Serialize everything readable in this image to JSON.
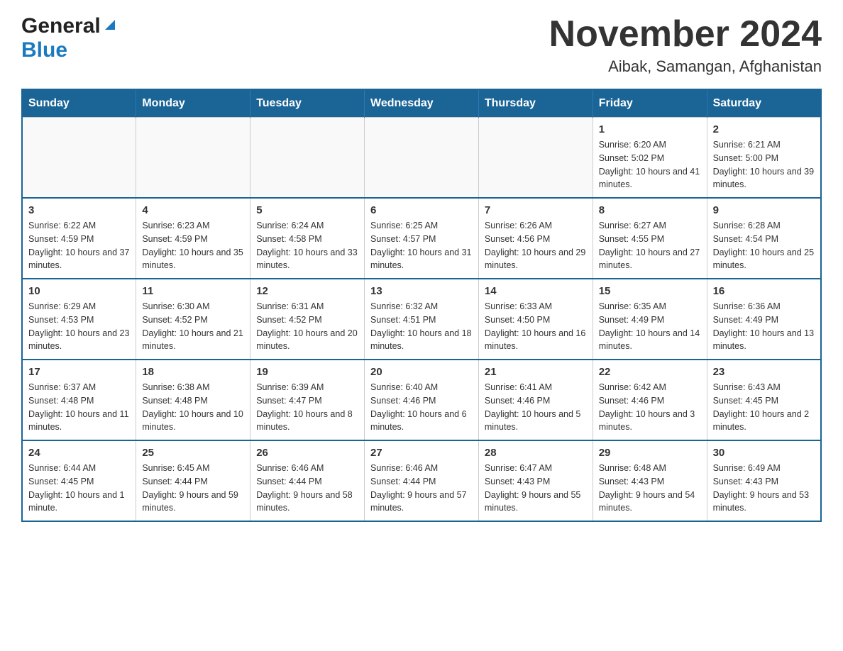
{
  "header": {
    "logo_general": "General",
    "logo_blue": "Blue",
    "month_title": "November 2024",
    "location": "Aibak, Samangan, Afghanistan"
  },
  "weekdays": [
    "Sunday",
    "Monday",
    "Tuesday",
    "Wednesday",
    "Thursday",
    "Friday",
    "Saturday"
  ],
  "weeks": [
    {
      "days": [
        {
          "number": "",
          "info": ""
        },
        {
          "number": "",
          "info": ""
        },
        {
          "number": "",
          "info": ""
        },
        {
          "number": "",
          "info": ""
        },
        {
          "number": "",
          "info": ""
        },
        {
          "number": "1",
          "info": "Sunrise: 6:20 AM\nSunset: 5:02 PM\nDaylight: 10 hours and 41 minutes."
        },
        {
          "number": "2",
          "info": "Sunrise: 6:21 AM\nSunset: 5:00 PM\nDaylight: 10 hours and 39 minutes."
        }
      ]
    },
    {
      "days": [
        {
          "number": "3",
          "info": "Sunrise: 6:22 AM\nSunset: 4:59 PM\nDaylight: 10 hours and 37 minutes."
        },
        {
          "number": "4",
          "info": "Sunrise: 6:23 AM\nSunset: 4:59 PM\nDaylight: 10 hours and 35 minutes."
        },
        {
          "number": "5",
          "info": "Sunrise: 6:24 AM\nSunset: 4:58 PM\nDaylight: 10 hours and 33 minutes."
        },
        {
          "number": "6",
          "info": "Sunrise: 6:25 AM\nSunset: 4:57 PM\nDaylight: 10 hours and 31 minutes."
        },
        {
          "number": "7",
          "info": "Sunrise: 6:26 AM\nSunset: 4:56 PM\nDaylight: 10 hours and 29 minutes."
        },
        {
          "number": "8",
          "info": "Sunrise: 6:27 AM\nSunset: 4:55 PM\nDaylight: 10 hours and 27 minutes."
        },
        {
          "number": "9",
          "info": "Sunrise: 6:28 AM\nSunset: 4:54 PM\nDaylight: 10 hours and 25 minutes."
        }
      ]
    },
    {
      "days": [
        {
          "number": "10",
          "info": "Sunrise: 6:29 AM\nSunset: 4:53 PM\nDaylight: 10 hours and 23 minutes."
        },
        {
          "number": "11",
          "info": "Sunrise: 6:30 AM\nSunset: 4:52 PM\nDaylight: 10 hours and 21 minutes."
        },
        {
          "number": "12",
          "info": "Sunrise: 6:31 AM\nSunset: 4:52 PM\nDaylight: 10 hours and 20 minutes."
        },
        {
          "number": "13",
          "info": "Sunrise: 6:32 AM\nSunset: 4:51 PM\nDaylight: 10 hours and 18 minutes."
        },
        {
          "number": "14",
          "info": "Sunrise: 6:33 AM\nSunset: 4:50 PM\nDaylight: 10 hours and 16 minutes."
        },
        {
          "number": "15",
          "info": "Sunrise: 6:35 AM\nSunset: 4:49 PM\nDaylight: 10 hours and 14 minutes."
        },
        {
          "number": "16",
          "info": "Sunrise: 6:36 AM\nSunset: 4:49 PM\nDaylight: 10 hours and 13 minutes."
        }
      ]
    },
    {
      "days": [
        {
          "number": "17",
          "info": "Sunrise: 6:37 AM\nSunset: 4:48 PM\nDaylight: 10 hours and 11 minutes."
        },
        {
          "number": "18",
          "info": "Sunrise: 6:38 AM\nSunset: 4:48 PM\nDaylight: 10 hours and 10 minutes."
        },
        {
          "number": "19",
          "info": "Sunrise: 6:39 AM\nSunset: 4:47 PM\nDaylight: 10 hours and 8 minutes."
        },
        {
          "number": "20",
          "info": "Sunrise: 6:40 AM\nSunset: 4:46 PM\nDaylight: 10 hours and 6 minutes."
        },
        {
          "number": "21",
          "info": "Sunrise: 6:41 AM\nSunset: 4:46 PM\nDaylight: 10 hours and 5 minutes."
        },
        {
          "number": "22",
          "info": "Sunrise: 6:42 AM\nSunset: 4:46 PM\nDaylight: 10 hours and 3 minutes."
        },
        {
          "number": "23",
          "info": "Sunrise: 6:43 AM\nSunset: 4:45 PM\nDaylight: 10 hours and 2 minutes."
        }
      ]
    },
    {
      "days": [
        {
          "number": "24",
          "info": "Sunrise: 6:44 AM\nSunset: 4:45 PM\nDaylight: 10 hours and 1 minute."
        },
        {
          "number": "25",
          "info": "Sunrise: 6:45 AM\nSunset: 4:44 PM\nDaylight: 9 hours and 59 minutes."
        },
        {
          "number": "26",
          "info": "Sunrise: 6:46 AM\nSunset: 4:44 PM\nDaylight: 9 hours and 58 minutes."
        },
        {
          "number": "27",
          "info": "Sunrise: 6:46 AM\nSunset: 4:44 PM\nDaylight: 9 hours and 57 minutes."
        },
        {
          "number": "28",
          "info": "Sunrise: 6:47 AM\nSunset: 4:43 PM\nDaylight: 9 hours and 55 minutes."
        },
        {
          "number": "29",
          "info": "Sunrise: 6:48 AM\nSunset: 4:43 PM\nDaylight: 9 hours and 54 minutes."
        },
        {
          "number": "30",
          "info": "Sunrise: 6:49 AM\nSunset: 4:43 PM\nDaylight: 9 hours and 53 minutes."
        }
      ]
    }
  ]
}
